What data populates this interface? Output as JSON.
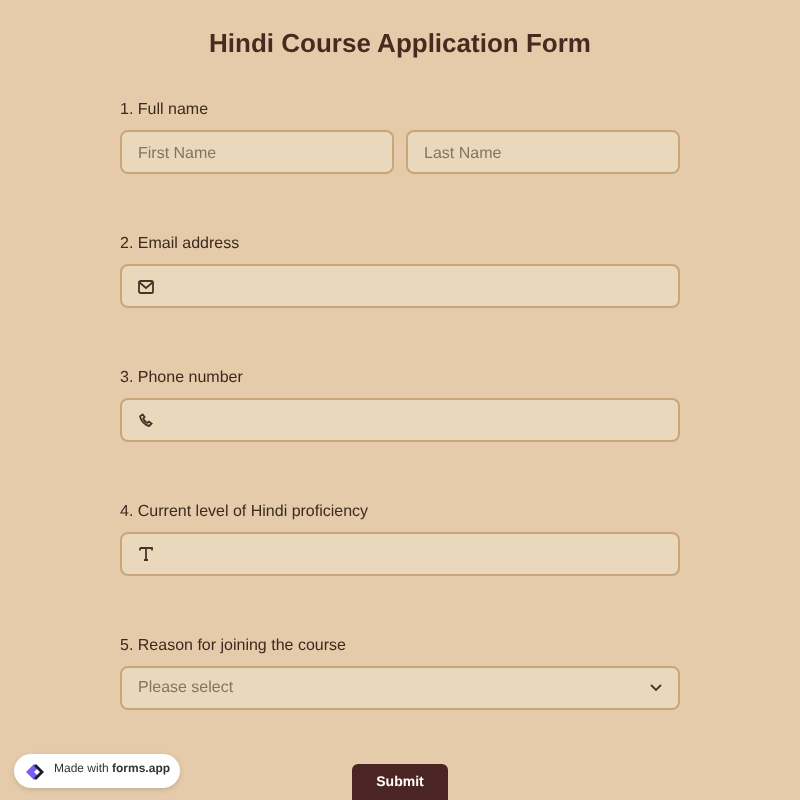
{
  "title": "Hindi Course Application Form",
  "questions": [
    {
      "kind": "name",
      "label": "1. Full name",
      "fields": [
        {
          "placeholder": "First Name"
        },
        {
          "placeholder": "Last Name"
        }
      ]
    },
    {
      "kind": "email",
      "label": "2. Email address"
    },
    {
      "kind": "phone",
      "label": "3. Phone number"
    },
    {
      "kind": "text",
      "label": "4. Current level of Hindi proficiency"
    },
    {
      "kind": "select",
      "label": "5. Reason for joining the course",
      "placeholder": "Please select"
    }
  ],
  "submit": "Submit",
  "badge": "Made with **forms.app**"
}
